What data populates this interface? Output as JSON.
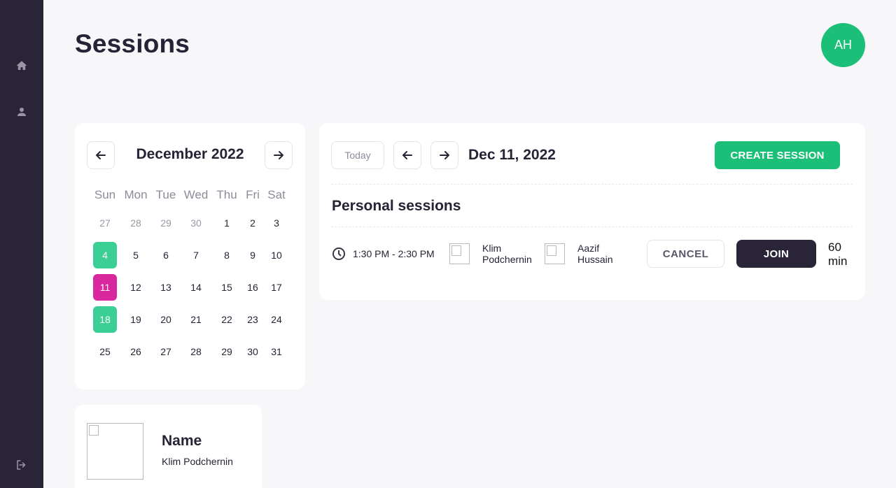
{
  "page": {
    "title": "Sessions"
  },
  "user": {
    "initials": "AH"
  },
  "sidebar": {
    "icons": [
      "home-icon",
      "user-icon",
      "logout-icon"
    ]
  },
  "calendar": {
    "month_label": "December 2022",
    "weekdays": [
      "Sun",
      "Mon",
      "Tue",
      "Wed",
      "Thu",
      "Fri",
      "Sat"
    ],
    "weeks": [
      [
        "27",
        "28",
        "29",
        "30",
        "1",
        "2",
        "3"
      ],
      [
        "4",
        "5",
        "6",
        "7",
        "8",
        "9",
        "10"
      ],
      [
        "11",
        "12",
        "13",
        "14",
        "15",
        "16",
        "17"
      ],
      [
        "18",
        "19",
        "20",
        "21",
        "22",
        "23",
        "24"
      ],
      [
        "25",
        "26",
        "27",
        "28",
        "29",
        "30",
        "31"
      ]
    ],
    "muted_days_first_week": 4,
    "selected_day": "11",
    "highlighted_days": [
      "4",
      "18"
    ],
    "colors": {
      "selected": "#d9279e",
      "highlighted": "#3ccf95"
    }
  },
  "sessions": {
    "today_label": "Today",
    "current_date": "Dec 11, 2022",
    "create_label": "CREATE SESSION",
    "section_title": "Personal sessions",
    "items": [
      {
        "time": "1:30 PM - 2:30 PM",
        "participant_1": {
          "first": "Klim",
          "last": "Podchernin"
        },
        "participant_2": {
          "first": "Aazif",
          "last": "Hussain"
        },
        "cancel_label": "CANCEL",
        "join_label": "JOIN",
        "duration_value": "60",
        "duration_unit": "min"
      }
    ]
  },
  "profile": {
    "label": "Name",
    "name": "Klim Podchernin"
  },
  "colors": {
    "accent_green": "#1bbf78",
    "dark": "#2a2438"
  }
}
